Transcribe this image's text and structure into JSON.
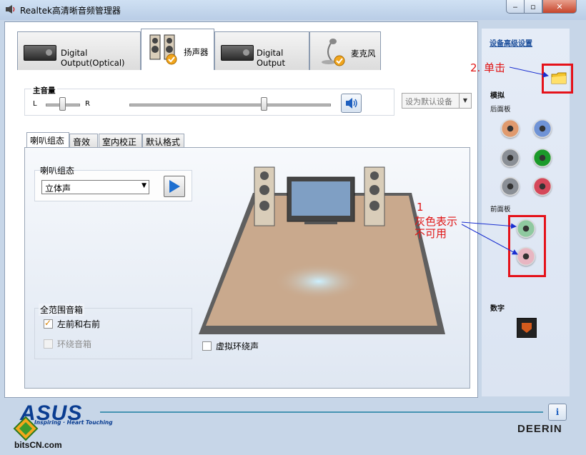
{
  "window": {
    "title": "Realtek高清晰音频管理器",
    "min_glyph": "‒",
    "max_glyph": "▫",
    "close_glyph": "✕"
  },
  "device_tabs": [
    {
      "label": "Digital Output(Optical)",
      "active": false
    },
    {
      "label": "扬声器",
      "active": true
    },
    {
      "label": "Digital Output",
      "active": false
    },
    {
      "label": "麦克风",
      "active": false
    }
  ],
  "master_volume": {
    "title": "主音量",
    "left_label": "L",
    "right_label": "R",
    "balance": 0.5,
    "level": 0.67
  },
  "default_device": {
    "label": "设为默认设备",
    "arrow": "▼"
  },
  "sub_tabs": [
    {
      "label": "喇叭组态",
      "active": true
    },
    {
      "label": "音效",
      "active": false
    },
    {
      "label": "室内校正",
      "active": false
    },
    {
      "label": "默认格式",
      "active": false
    }
  ],
  "speaker_config": {
    "title": "喇叭组态",
    "selected": "立体声",
    "arrow": "▼"
  },
  "full_range": {
    "title": "全范围音箱",
    "options": [
      {
        "label": "左前和右前",
        "checked": true,
        "enabled": true
      },
      {
        "label": "环绕音箱",
        "checked": false,
        "enabled": false
      }
    ]
  },
  "virtual_surround": {
    "label": "虚拟环绕声",
    "checked": false
  },
  "side_panel": {
    "advanced_link": "设备高级设置",
    "analog_title": "模拟",
    "back_panel": "后面板",
    "front_panel": "前面板",
    "digital_title": "数字",
    "back_jacks": [
      {
        "color": "#e09a6e"
      },
      {
        "color": "#6f93d6"
      },
      {
        "color": "#8a8f96"
      },
      {
        "color": "#1b9a2a"
      },
      {
        "color": "#8a8f96"
      },
      {
        "color": "#d5485a"
      }
    ],
    "front_jacks": [
      {
        "color": "#8fc9a0"
      },
      {
        "color": "#e8b6c2"
      }
    ]
  },
  "annotations": {
    "step2": "2. 单击",
    "step1_number": "1",
    "step1_line1": "灰色表示",
    "step1_line2": "不可用"
  },
  "bottom": {
    "asus_logo": "ASUS",
    "asus_tagline": "Inspiring · Heart Touching",
    "site_logo": "bitsCN.com",
    "info_glyph": "i",
    "deerin_logo": "DEERIN"
  },
  "colors": {
    "accent": "#1a4d9a",
    "annotation": "#e01616",
    "panel": "#dbe4f2"
  }
}
